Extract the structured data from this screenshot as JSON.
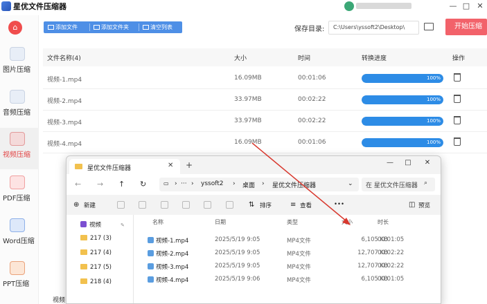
{
  "app": {
    "title": "星优文件压缩器",
    "user_name": "yssoft2",
    "window_controls": [
      "—",
      "□",
      "✕"
    ]
  },
  "sidebar": {
    "items": [
      {
        "label": "图片压缩",
        "icon": "image-icon",
        "active": false
      },
      {
        "label": "音频压缩",
        "icon": "music-icon",
        "active": false
      },
      {
        "label": "视频压缩",
        "icon": "video-icon",
        "active": true
      },
      {
        "label": "PDF压缩",
        "icon": "pdf-icon",
        "active": false
      },
      {
        "label": "Word压缩",
        "icon": "word-icon",
        "active": false
      },
      {
        "label": "PPT压缩",
        "icon": "ppt-icon",
        "active": false
      }
    ]
  },
  "toolbar": {
    "add_file": "添加文件",
    "add_folder": "添加文件夹",
    "clear_list": "清空列表",
    "save_label": "保存目录:",
    "save_path": "C:\\Users\\yssoft2\\Desktop\\",
    "start_label": "开始压缩"
  },
  "table": {
    "columns": [
      "文件名称(4)",
      "大小",
      "时间",
      "转换进度",
      "操作"
    ],
    "rows": [
      {
        "name": "视频-1.mp4",
        "size": "16.09MB",
        "time": "00:01:06",
        "progress": 100,
        "progress_label": "100%"
      },
      {
        "name": "视频-2.mp4",
        "size": "33.97MB",
        "time": "00:02:22",
        "progress": 100,
        "progress_label": "100%"
      },
      {
        "name": "视频-3.mp4",
        "size": "33.97MB",
        "time": "00:02:22",
        "progress": 100,
        "progress_label": "100%"
      },
      {
        "name": "视频-4.mp4",
        "size": "16.09MB",
        "time": "00:01:06",
        "progress": 100,
        "progress_label": "100%"
      }
    ]
  },
  "explorer": {
    "tab_title": "星优文件压缩器",
    "breadcrumb": [
      "yssoft2",
      "桌面",
      "星优文件压缩器"
    ],
    "search_placeholder": "在 星优文件压缩器",
    "commands": {
      "new": "新建",
      "sort": "排序",
      "view": "查看",
      "more": "•••",
      "preview": "预览"
    },
    "nav_items": [
      "视频",
      "217 (3)",
      "217 (4)",
      "217 (5)",
      "218 (4)"
    ],
    "columns": [
      "名称",
      "日期",
      "类型",
      "大小",
      "时长"
    ],
    "files": [
      {
        "name": "视频-1.mp4",
        "date": "2025/5/19 9:05",
        "type": "MP4文件",
        "size": "6,105 KB",
        "duration": "00:01:05"
      },
      {
        "name": "视频-2.mp4",
        "date": "2025/5/19 9:05",
        "type": "MP4文件",
        "size": "12,707 KB",
        "duration": "00:02:22"
      },
      {
        "name": "视频-3.mp4",
        "date": "2025/5/19 9:05",
        "type": "MP4文件",
        "size": "12,707 KB",
        "duration": "00:02:22"
      },
      {
        "name": "视频-4.mp4",
        "date": "2025/5/19 9:06",
        "type": "MP4文件",
        "size": "6,105 KB",
        "duration": "00:01:05"
      }
    ]
  },
  "bottom_label": "视频",
  "colors": {
    "accent": "#f2626a",
    "toolbar": "#4e8fe6",
    "progress": "#2d8ce6",
    "arrow": "#d8382e"
  }
}
